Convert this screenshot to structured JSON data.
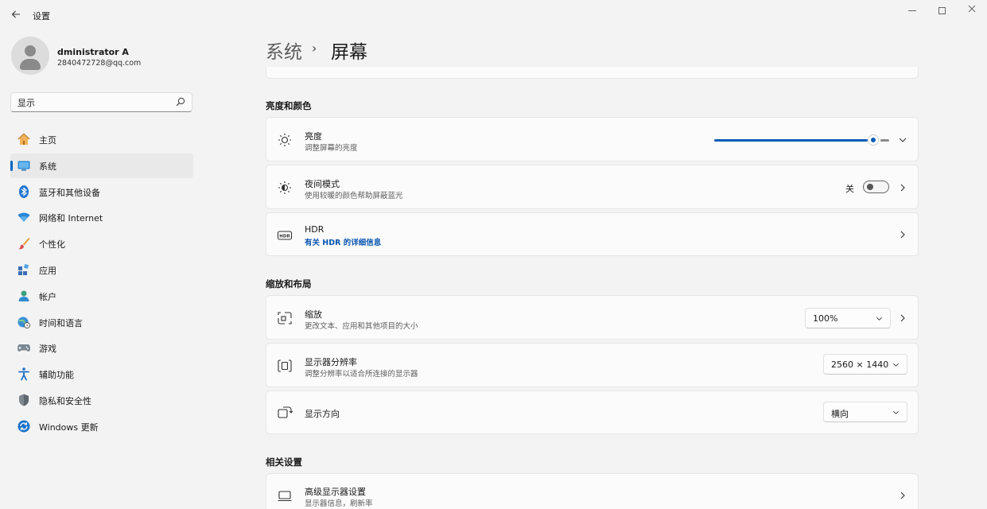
{
  "window": {
    "title": "设置",
    "back_icon": "back-arrow-icon"
  },
  "profile": {
    "name": "dministrator A",
    "email": "2840472728@qq.com"
  },
  "search": {
    "value": "显示",
    "icon": "search-icon"
  },
  "nav": {
    "items": [
      {
        "label": "主页",
        "icon": "home-icon",
        "active": false
      },
      {
        "label": "系统",
        "icon": "system-icon",
        "active": true
      },
      {
        "label": "蓝牙和其他设备",
        "icon": "bluetooth-icon",
        "active": false
      },
      {
        "label": "网络和 Internet",
        "icon": "wifi-icon",
        "active": false
      },
      {
        "label": "个性化",
        "icon": "brush-icon",
        "active": false
      },
      {
        "label": "应用",
        "icon": "apps-icon",
        "active": false
      },
      {
        "label": "帐户",
        "icon": "account-icon",
        "active": false
      },
      {
        "label": "时间和语言",
        "icon": "globe-clock-icon",
        "active": false
      },
      {
        "label": "游戏",
        "icon": "gamepad-icon",
        "active": false
      },
      {
        "label": "辅助功能",
        "icon": "accessibility-icon",
        "active": false
      },
      {
        "label": "隐私和安全性",
        "icon": "shield-icon",
        "active": false
      },
      {
        "label": "Windows 更新",
        "icon": "update-icon",
        "active": false
      }
    ]
  },
  "breadcrumb": {
    "parent": "系统",
    "separator": "›",
    "current": "屏幕"
  },
  "sections": {
    "brightness_color": {
      "title": "亮度和颜色",
      "brightness": {
        "title": "亮度",
        "subtitle": "调整屏幕的亮度",
        "value_percent": 91
      },
      "night_light": {
        "title": "夜间模式",
        "subtitle": "使用较暖的颜色帮助屏蔽蓝光",
        "state_label": "关"
      },
      "hdr": {
        "title": "HDR",
        "link": "有关 HDR 的详细信息"
      }
    },
    "scale_layout": {
      "title": "缩放和布局",
      "scale": {
        "title": "缩放",
        "subtitle": "更改文本、应用和其他项目的大小",
        "value": "100%"
      },
      "resolution": {
        "title": "显示器分辨率",
        "subtitle": "调整分辨率以适合所连接的显示器",
        "value": "2560 × 1440"
      },
      "orientation": {
        "title": "显示方向",
        "value": "横向"
      }
    },
    "related": {
      "title": "相关设置",
      "advanced": {
        "title": "高级显示器设置",
        "subtitle": "显示器信息，刷新率"
      }
    }
  },
  "colors": {
    "accent": "#0a5cb8",
    "background": "#f3f3f3",
    "card": "#fbfbfb"
  }
}
